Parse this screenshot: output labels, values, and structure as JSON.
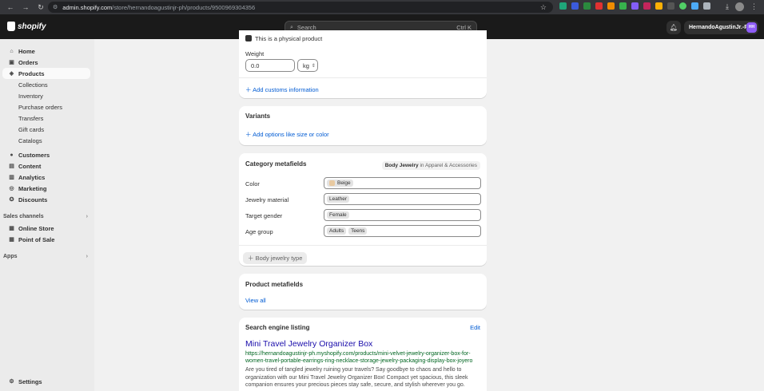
{
  "browser": {
    "url_host": "admin.shopify.com",
    "url_path": "/store/hernandoagustinjr-ph/products/9500969304356"
  },
  "topbar": {
    "brand": "shopify",
    "search_placeholder": "Search",
    "search_shortcut": "Ctrl K",
    "user_name": "HernandoAgustinJr.-PH",
    "user_initials": "HH"
  },
  "sidebar": {
    "home": "Home",
    "orders": "Orders",
    "products": "Products",
    "collections": "Collections",
    "inventory": "Inventory",
    "purchase_orders": "Purchase orders",
    "transfers": "Transfers",
    "gift_cards": "Gift cards",
    "catalogs": "Catalogs",
    "customers": "Customers",
    "content": "Content",
    "analytics": "Analytics",
    "marketing": "Marketing",
    "discounts": "Discounts",
    "sales_channels": "Sales channels",
    "online_store": "Online Store",
    "point_of_sale": "Point of Sale",
    "apps": "Apps",
    "settings": "Settings"
  },
  "shipping": {
    "physical_label": "This is a physical product",
    "weight_label": "Weight",
    "weight_value": "0.0",
    "weight_unit": "kg",
    "customs_link": "Add customs information"
  },
  "variants": {
    "title": "Variants",
    "add_link": "Add options like size or color"
  },
  "category_metafields": {
    "title": "Category metafields",
    "badge_category": "Body Jewelry",
    "badge_in": "in Apparel & Accessories",
    "color_label": "Color",
    "color_value": "Beige",
    "material_label": "Jewelry material",
    "material_value": "Leather",
    "gender_label": "Target gender",
    "gender_value": "Female",
    "age_label": "Age group",
    "age_values": [
      "Adults",
      "Teens"
    ],
    "type_button": "Body jewelry type"
  },
  "product_metafields": {
    "title": "Product metafields",
    "view_all": "View all"
  },
  "seo": {
    "title": "Search engine listing",
    "edit": "Edit",
    "page_title": "Mini Travel Jewelry Organizer Box",
    "url": "https://hernandoagustinjr-ph.myshopify.com/products/mini-velvet-jewelry-organizer-box-for-women-travel-portable-earrings-ring-necklace-storage-jewelry-packaging-display-box-joyero",
    "description": "Are you tired of tangled jewelry ruining your travels? Say goodbye to chaos and hello to organization with our Mini Travel Jewelry Organizer Box! Compact yet spacious, this sleek companion ensures your precious pieces stay safe, secure, and stylish wherever you go."
  }
}
